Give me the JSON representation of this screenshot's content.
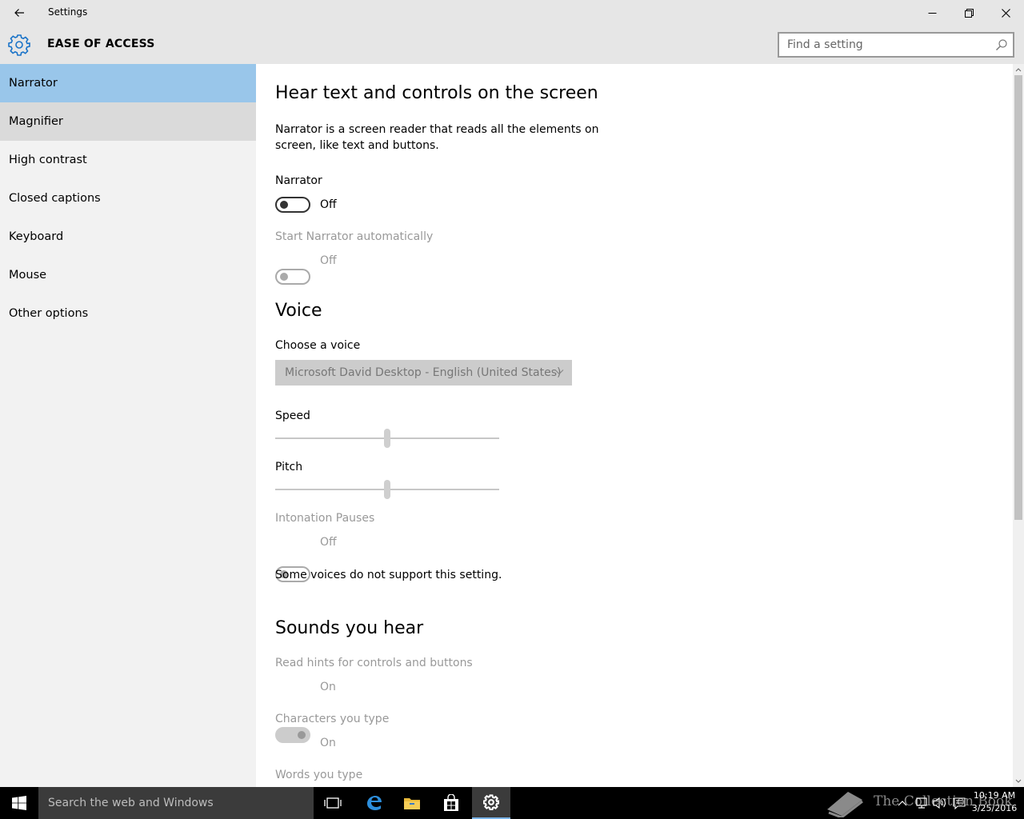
{
  "window": {
    "title": "Settings"
  },
  "header": {
    "section_title": "EASE OF ACCESS",
    "search_placeholder": "Find a setting"
  },
  "sidebar": {
    "items": [
      {
        "label": "Narrator",
        "state": "selected"
      },
      {
        "label": "Magnifier",
        "state": "hover"
      },
      {
        "label": "High contrast",
        "state": "normal"
      },
      {
        "label": "Closed captions",
        "state": "normal"
      },
      {
        "label": "Keyboard",
        "state": "normal"
      },
      {
        "label": "Mouse",
        "state": "normal"
      },
      {
        "label": "Other options",
        "state": "normal"
      }
    ]
  },
  "main": {
    "heading": "Hear text and controls on the screen",
    "description": "Narrator is a screen reader that reads all the elements on screen, like text and buttons.",
    "narrator": {
      "label": "Narrator",
      "state": "Off",
      "enabled": true
    },
    "start_auto": {
      "label": "Start Narrator automatically",
      "state": "Off",
      "enabled": false
    },
    "voice": {
      "heading": "Voice",
      "choose_label": "Choose a voice",
      "selected_voice": "Microsoft David Desktop - English (United States)",
      "speed_label": "Speed",
      "speed_value": 0.5,
      "pitch_label": "Pitch",
      "pitch_value": 0.5,
      "intonation": {
        "label": "Intonation Pauses",
        "state": "Off",
        "enabled": false
      },
      "note": "Some voices do not support this setting."
    },
    "sounds": {
      "heading": "Sounds you hear",
      "read_hints": {
        "label": "Read hints for controls and buttons",
        "state": "On",
        "enabled": false
      },
      "characters": {
        "label": "Characters you type",
        "state": "On",
        "enabled": false
      },
      "words_label": "Words you type"
    }
  },
  "taskbar": {
    "search_text": "Search the web and Windows",
    "watermark": "The Collection Book",
    "time": "10:19 AM",
    "date": "3/25/2016"
  },
  "colors": {
    "accent": "#0078d7",
    "selected_nav": "#99c6ea",
    "hover_nav": "#dadada",
    "chrome": "#e6e6e6",
    "sidebar_bg": "#f2f2f2"
  }
}
